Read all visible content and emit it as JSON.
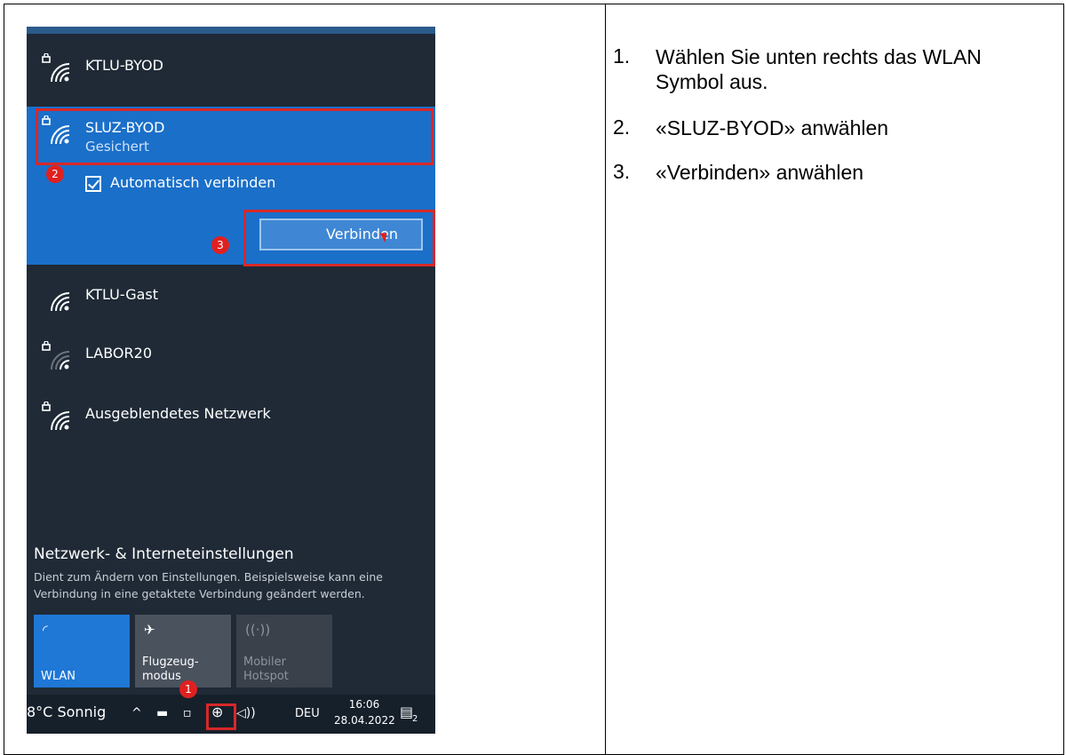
{
  "networks": {
    "top": "KTLU-BYOD",
    "selected": {
      "name": "SLUZ-BYOD",
      "status": "Gesichert",
      "auto_connect_label": "Automatisch verbinden",
      "connect_button": "Verbinden"
    },
    "others": [
      "KTLU-Gast",
      "LABOR20",
      "Ausgeblendetes Netzwerk"
    ]
  },
  "settings": {
    "title": "Netzwerk- & Interneteinstellungen",
    "description": "Dient zum Ändern von Einstellungen. Beispielsweise kann eine Verbindung in eine getaktete Verbindung geändert werden."
  },
  "tiles": {
    "wlan": "WLAN",
    "flugzeug_line1": "Flugzeug-",
    "flugzeug_line2": "modus",
    "hotspot_line1": "Mobiler",
    "hotspot_line2": "Hotspot"
  },
  "taskbar": {
    "weather": "8°C Sonnig",
    "language": "DEU",
    "time": "16:06",
    "date": "28.04.2022",
    "notifications": "2"
  },
  "badges": {
    "one": "1",
    "two": "2",
    "three": "3"
  },
  "steps": [
    {
      "num": "1.",
      "text": "Wählen Sie unten rechts das WLAN Symbol aus."
    },
    {
      "num": "2.",
      "text": "«SLUZ-BYOD» anwählen"
    },
    {
      "num": "3.",
      "text": "«Verbinden» anwählen"
    }
  ]
}
